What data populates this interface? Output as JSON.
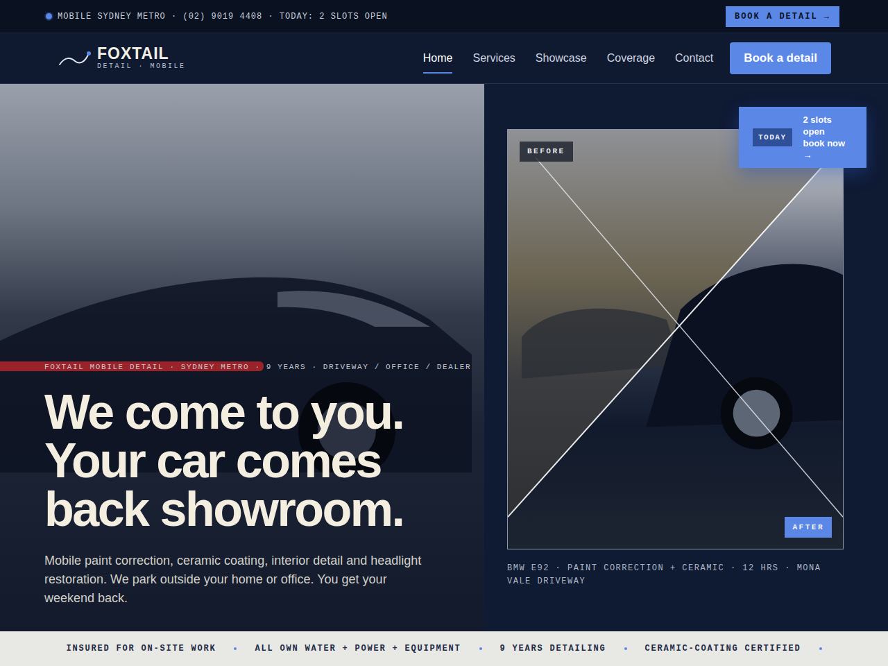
{
  "topbar": {
    "text": "MOBILE SYDNEY METRO · (02) 9019 4408 · TODAY: 2 SLOTS OPEN",
    "button": "BOOK A DETAIL →"
  },
  "brand": {
    "name": "FOXTAIL",
    "tagline": "DETAIL · MOBILE"
  },
  "nav": [
    {
      "label": "Home",
      "selected": true
    },
    {
      "label": "Services",
      "selected": false
    },
    {
      "label": "Showcase",
      "selected": false
    },
    {
      "label": "Coverage",
      "selected": false
    },
    {
      "label": "Contact",
      "selected": false
    }
  ],
  "nav_button": "Book a detail",
  "hero": {
    "eyebrow": "FOXTAIL MOBILE DETAIL · SYDNEY METRO · 9 YEARS · DRIVEWAY / OFFICE / DEALER",
    "headline": [
      "We come to you.",
      "Your car comes",
      "back showroom."
    ],
    "body": "Mobile paint correction, ceramic coating, interior detail and headlight restoration. We park outside your home or office. You get your weekend back."
  },
  "showcase": {
    "badge_label": "TODAY",
    "badge_lines": [
      "2 slots open",
      "book now →"
    ],
    "before": "BEFORE",
    "after": "AFTER",
    "caption": "BMW E92 · PAINT CORRECTION + CERAMIC · 12 HRS · MONA VALE DRIVEWAY"
  },
  "trust": [
    "INSURED FOR ON-SITE WORK",
    "ALL OWN WATER + POWER + EQUIPMENT",
    "9 YEARS DETAILING",
    "CERAMIC-COATING CERTIFIED"
  ]
}
